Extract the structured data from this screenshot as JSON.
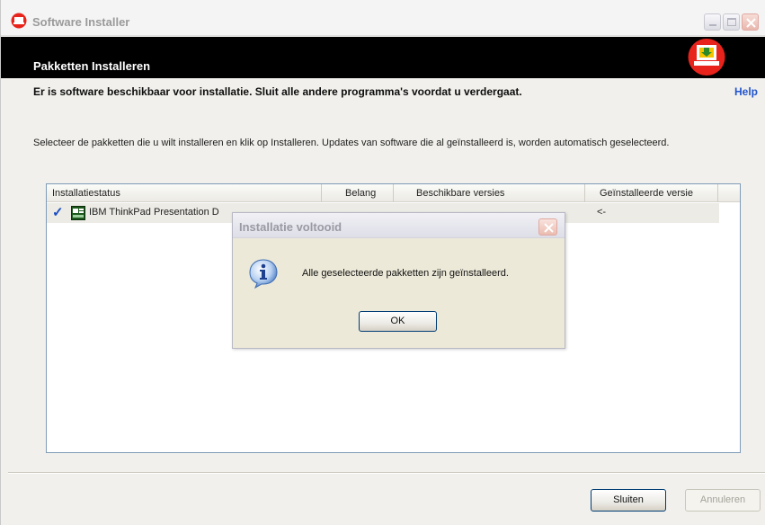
{
  "window": {
    "title": "Software Installer",
    "icon": "app-red-icon",
    "controls": [
      "minimize-icon",
      "maximize-icon",
      "close-icon"
    ]
  },
  "banner": {
    "title": "Pakketten Installeren",
    "icon": "install-download-icon"
  },
  "notice": {
    "text": "Er is software beschikbaar voor installatie. Sluit alle andere programma's voordat u verdergaat.",
    "help_label": "Help"
  },
  "instructions": "Selecteer de pakketten die u wilt installeren en klik op Installeren. Updates van software die al geïnstalleerd is, worden automatisch geselecteerd.",
  "table": {
    "columns": [
      "Installatiestatus",
      "Belang",
      "Beschikbare versies",
      "Geïnstalleerde versie"
    ],
    "rows": [
      {
        "status_icon": "checkmark-icon",
        "package_icon": "package-icon",
        "name": "IBM ThinkPad Presentation D",
        "belang": "",
        "beschikbare_versie": "",
        "geinstalleerde_versie": "<-"
      }
    ]
  },
  "buttons": {
    "close_label": "Sluiten",
    "cancel_label": "Annuleren"
  },
  "dialog": {
    "title": "Installatie voltooid",
    "message": "Alle geselecteerde pakketten zijn geïnstalleerd.",
    "ok_label": "OK",
    "icon": "info-icon"
  },
  "colors": {
    "banner_bg": "#000000",
    "help_link": "#2255cc",
    "check": "#1b4fc2",
    "accent_red": "#e8231c"
  }
}
